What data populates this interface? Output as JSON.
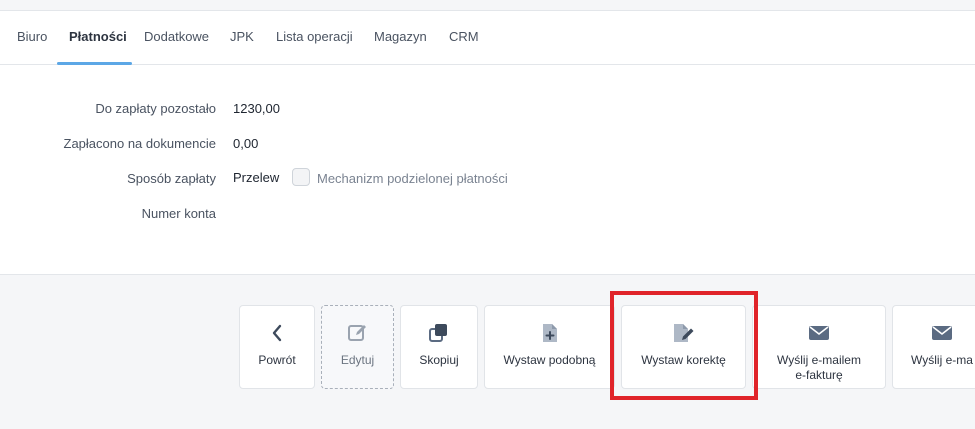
{
  "tabs": [
    {
      "label": "Biuro"
    },
    {
      "label": "Płatności"
    },
    {
      "label": "Dodatkowe"
    },
    {
      "label": "JPK"
    },
    {
      "label": "Lista operacji"
    },
    {
      "label": "Magazyn"
    },
    {
      "label": "CRM"
    }
  ],
  "active_tab": "Płatności",
  "payment": {
    "remaining_label": "Do zapłaty pozostało",
    "remaining_value": "1230,00",
    "paid_label": "Zapłacono na dokumencie",
    "paid_value": "0,00",
    "method_label": "Sposób zapłaty",
    "method_value": "Przelew",
    "split_payment_label": "Mechanizm podzielonej płatności",
    "split_payment_checked": false,
    "account_label": "Numer konta",
    "account_value": ""
  },
  "actions": [
    {
      "label": "Powrót",
      "icon": "chevron-left-icon"
    },
    {
      "label": "Edytuj",
      "icon": "edit-icon"
    },
    {
      "label": "Skopiuj",
      "icon": "copy-icon"
    },
    {
      "label": "Wystaw podobną",
      "icon": "file-plus-icon"
    },
    {
      "label": "Wystaw korektę",
      "icon": "file-edit-icon"
    },
    {
      "label": "Wyślij e-mailem e-fakturę",
      "line1": "Wyślij e-mailem",
      "line2": "e-fakturę",
      "icon": "envelope-icon"
    },
    {
      "label": "Wyślij e-ma",
      "icon": "envelope-icon"
    }
  ],
  "colors": {
    "accent": "#5ca7e6",
    "icon": "#5b6b82",
    "highlight": "#e0242a"
  }
}
